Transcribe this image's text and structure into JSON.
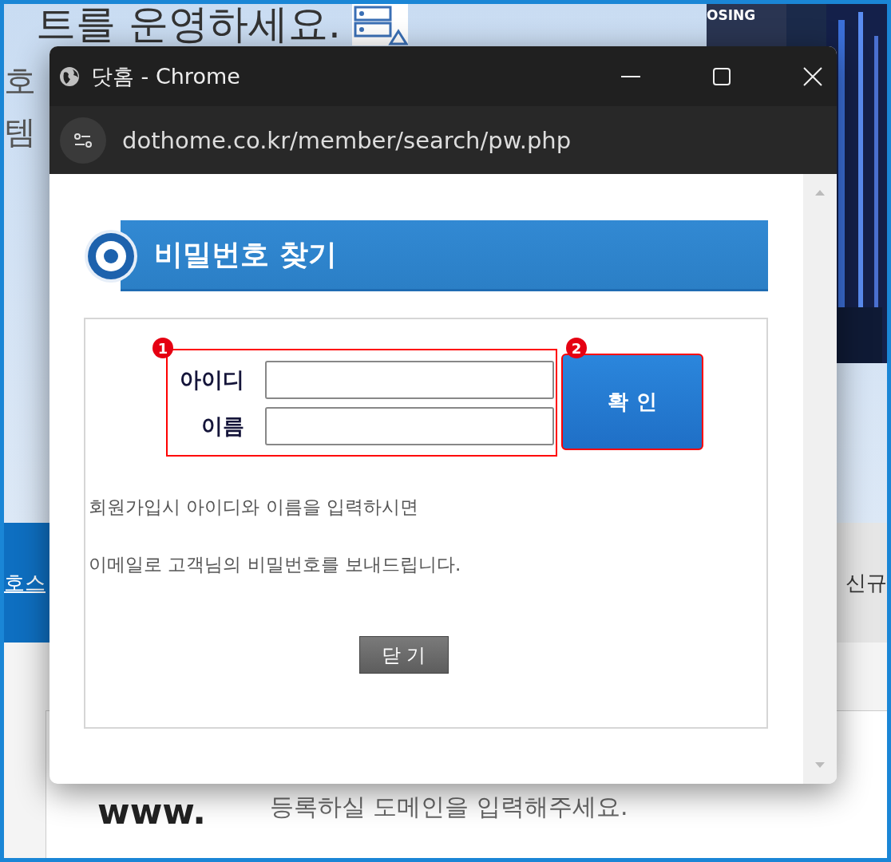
{
  "background_page": {
    "headline": "트를 운영하세요.",
    "banner_text": "OSING",
    "side_texts": [
      "호",
      "템"
    ],
    "nav": {
      "left": "호스",
      "right": "신규"
    },
    "domain": {
      "prefix": "www.",
      "hint": "등록하실 도메인을 입력해주세요."
    }
  },
  "window": {
    "title": "닷홈 - Chrome",
    "url": "dothome.co.kr/member/search/pw.php"
  },
  "page": {
    "heading": "비밀번호 찾기",
    "fields": [
      {
        "label": "아이디"
      },
      {
        "label": "이름"
      }
    ],
    "confirm_button": "확 인",
    "notes": [
      "회원가입시 아이디와 이름을 입력하시면",
      "이메일로 고객님의 비밀번호를 보내드립니다."
    ],
    "close_button": "닫 기"
  },
  "annotations": [
    "1",
    "2"
  ]
}
